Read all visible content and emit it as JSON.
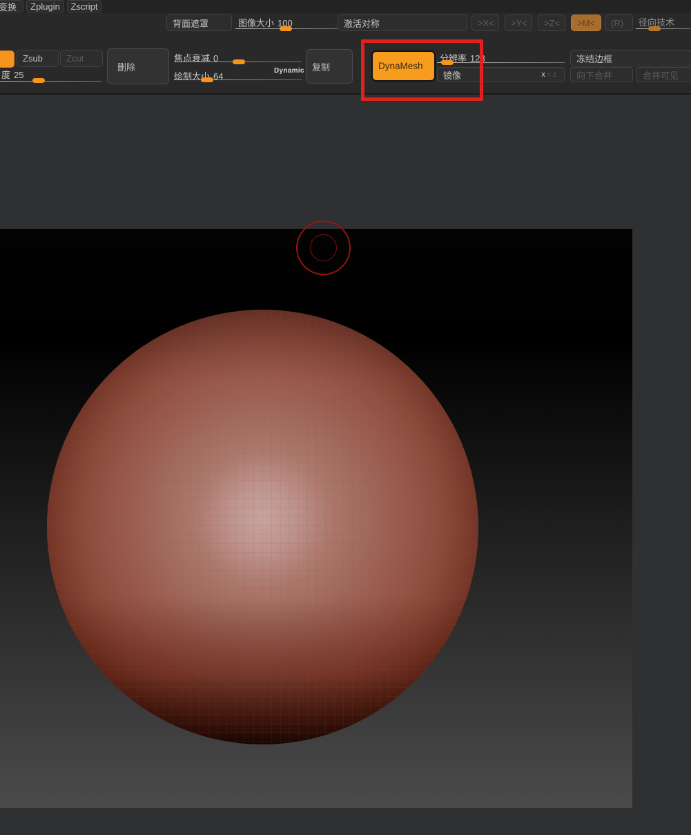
{
  "colors": {
    "accent_orange": "#f7941e",
    "active_symmetry_orange": "#a86c2e",
    "annotation_red": "#e2211c",
    "toolbar_bg": "#29292a",
    "canvas_top": "#000000",
    "canvas_bottom": "#4b4b4b",
    "sphere_material": "red-wax"
  },
  "tabs": {
    "transform": "变换",
    "zplugin": "Zplugin",
    "zscript": "Zscript"
  },
  "row1": {
    "backface_mask": "背面遮罩",
    "image_size": {
      "label": "图像大小",
      "value": "100"
    },
    "activate_symmetry": "激活对称",
    "sym_x": ">X<",
    "sym_y": ">Y<",
    "sym_z": ">Z<",
    "sym_m": ">M<",
    "sym_r": "(R)",
    "radial_count": {
      "label": "径向技术"
    }
  },
  "row2": {
    "zadd": "",
    "zsub": "Zsub",
    "zcut": "Zcut",
    "delete": "删除",
    "focal_shift": {
      "label": "焦点衰减",
      "value": "0"
    },
    "draw_size": {
      "label": "绘制大小",
      "value": "64"
    },
    "dynamic_badge": "Dynamic",
    "duplicate": "复制",
    "dynamesh": "DynaMesh",
    "resolution": {
      "label": "分辨率",
      "value": "128"
    },
    "mirror": {
      "label": "镜像",
      "axis_x": "X",
      "axis_y": "Y",
      "axis_z": "Z"
    },
    "freeze_border": "冻结边框",
    "merge_down": "向下合并",
    "merge_visible": "合并可见",
    "z_intensity": {
      "label": "度",
      "value": "25"
    }
  }
}
